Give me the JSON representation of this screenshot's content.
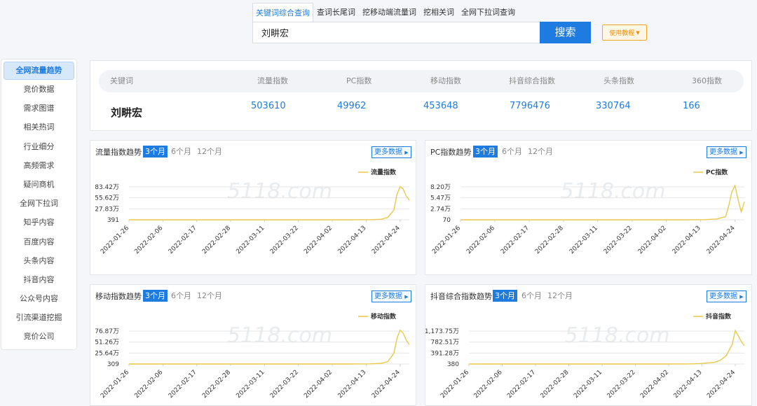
{
  "search": {
    "tabs": [
      "关键词综合查询",
      "查词长尾词",
      "挖移动端流量词",
      "挖相关词",
      "全网下拉词查询"
    ],
    "query": "刘畊宏",
    "button": "搜索",
    "tutorial": "使用教程"
  },
  "sidebar": {
    "items": [
      "全网流量趋势",
      "竞价数据",
      "需求图谱",
      "相关热词",
      "行业细分",
      "高频需求",
      "疑问商机",
      "全网下拉词",
      "知乎内容",
      "百度内容",
      "头条内容",
      "抖音内容",
      "公众号内容",
      "引流渠道挖掘",
      "竞价公司"
    ]
  },
  "summary": {
    "headers": [
      "关键词",
      "流量指数",
      "PC指数",
      "移动指数",
      "抖音综合指数",
      "头条指数",
      "360指数"
    ],
    "keyword": "刘畊宏",
    "values": [
      "503610",
      "49962",
      "453648",
      "7796476",
      "330764",
      "166"
    ]
  },
  "periods": [
    "3个月",
    "6个月",
    "12个月"
  ],
  "more_label": "更多数据",
  "x_ticks": [
    "2022-01-26",
    "2022-02-06",
    "2022-02-17",
    "2022-02-28",
    "2022-03-11",
    "2022-03-22",
    "2022-04-02",
    "2022-04-13",
    "2022-04-24"
  ],
  "colors": {
    "accent": "#1e7be0",
    "line": "#e8c94a",
    "grid": "#e6e6e6"
  },
  "chart_data": [
    {
      "type": "line",
      "title": "流量指数趋势",
      "series": [
        {
          "name": "流量指数"
        }
      ],
      "y_ticks": [
        "391",
        "27.83万",
        "55.62万",
        "83.42万"
      ],
      "ylim": [
        391,
        834200
      ],
      "x_range": [
        "2022-01-26",
        "2022-04-27"
      ],
      "points": [
        [
          "2022-01-26",
          391
        ],
        [
          "2022-04-08",
          391
        ],
        [
          "2022-04-14",
          3000
        ],
        [
          "2022-04-18",
          15000
        ],
        [
          "2022-04-20",
          60000
        ],
        [
          "2022-04-22",
          250000
        ],
        [
          "2022-04-23",
          650000
        ],
        [
          "2022-04-24",
          840000
        ],
        [
          "2022-04-25",
          780000
        ],
        [
          "2022-04-26",
          600000
        ],
        [
          "2022-04-27",
          500000
        ]
      ]
    },
    {
      "type": "line",
      "title": "PC指数趋势",
      "series": [
        {
          "name": "PC指数"
        }
      ],
      "y_ticks": [
        "70",
        "2.74万",
        "5.47万",
        "8.20万"
      ],
      "ylim": [
        70,
        82000
      ],
      "x_range": [
        "2022-01-26",
        "2022-04-27"
      ],
      "points": [
        [
          "2022-01-26",
          70
        ],
        [
          "2022-04-08",
          70
        ],
        [
          "2022-04-14",
          500
        ],
        [
          "2022-04-18",
          2000
        ],
        [
          "2022-04-21",
          8000
        ],
        [
          "2022-04-22",
          35000
        ],
        [
          "2022-04-23",
          70000
        ],
        [
          "2022-04-24",
          85000
        ],
        [
          "2022-04-25",
          50000
        ],
        [
          "2022-04-26",
          20000
        ],
        [
          "2022-04-27",
          45000
        ]
      ]
    },
    {
      "type": "line",
      "title": "移动指数趋势",
      "series": [
        {
          "name": "移动指数"
        }
      ],
      "y_ticks": [
        "309",
        "25.64万",
        "51.26万",
        "76.87万"
      ],
      "ylim": [
        309,
        768700
      ],
      "x_range": [
        "2022-01-26",
        "2022-04-27"
      ],
      "points": [
        [
          "2022-01-26",
          309
        ],
        [
          "2022-04-08",
          309
        ],
        [
          "2022-04-14",
          3000
        ],
        [
          "2022-04-18",
          15000
        ],
        [
          "2022-04-20",
          55000
        ],
        [
          "2022-04-22",
          250000
        ],
        [
          "2022-04-23",
          600000
        ],
        [
          "2022-04-24",
          790000
        ],
        [
          "2022-04-25",
          720000
        ],
        [
          "2022-04-26",
          560000
        ],
        [
          "2022-04-27",
          450000
        ]
      ]
    },
    {
      "type": "line",
      "title": "抖音综合指数趋势",
      "series": [
        {
          "name": "抖音指数"
        }
      ],
      "y_ticks": [
        "380",
        "391.28万",
        "782.51万",
        "1,173.75万"
      ],
      "ylim": [
        380,
        11737500
      ],
      "x_range": [
        "2022-01-26",
        "2022-04-27"
      ],
      "points": [
        [
          "2022-01-26",
          380
        ],
        [
          "2022-04-02",
          380
        ],
        [
          "2022-04-08",
          30000
        ],
        [
          "2022-04-12",
          150000
        ],
        [
          "2022-04-15",
          400000
        ],
        [
          "2022-04-17",
          550000
        ],
        [
          "2022-04-19",
          1300000
        ],
        [
          "2022-04-21",
          3000000
        ],
        [
          "2022-04-23",
          7000000
        ],
        [
          "2022-04-24",
          11900000
        ],
        [
          "2022-04-25",
          10000000
        ],
        [
          "2022-04-26",
          8000000
        ],
        [
          "2022-04-27",
          6500000
        ]
      ]
    }
  ]
}
